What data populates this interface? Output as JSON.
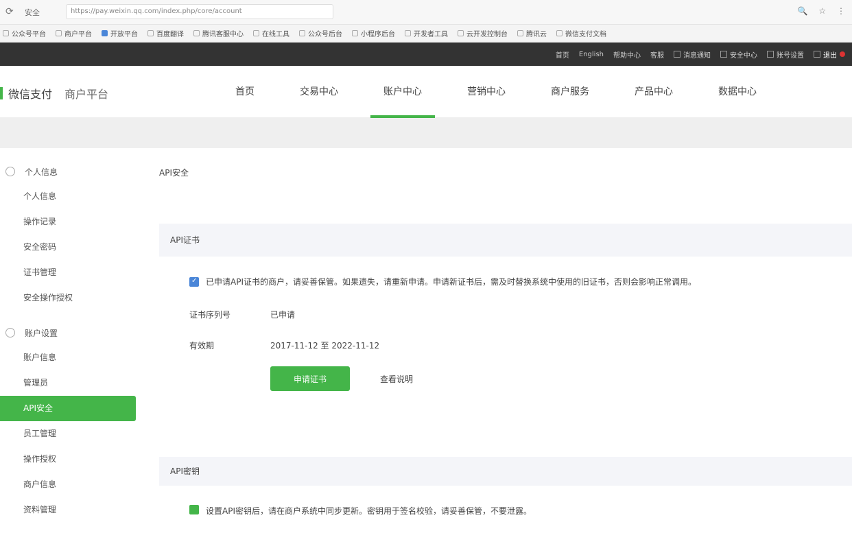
{
  "browser": {
    "secure_label": "安全",
    "url": "https://pay.weixin.qq.com/index.php/core/account",
    "bookmarks": [
      "公众号平台",
      "商户平台",
      "开放平台",
      "百度翻译",
      "腾讯客服中心",
      "在线工具",
      "公众号后台",
      "小程序后台",
      "开发者工具",
      "云开发控制台",
      "腾讯云",
      "微信支付文档"
    ]
  },
  "topbar": {
    "links": [
      "首页",
      "English",
      "帮助中心",
      "客服",
      "消息通知",
      "安全中心",
      "账号设置",
      "退出"
    ]
  },
  "header": {
    "brand_primary": "微信支付",
    "brand_secondary": "商户平台",
    "nav": [
      "首页",
      "交易中心",
      "账户中心",
      "营销中心",
      "商户服务",
      "产品中心",
      "数据中心"
    ],
    "active_nav_index": 2
  },
  "sidebar": {
    "group1_label": "个人信息",
    "group1_items": [
      "个人信息",
      "操作记录",
      "安全密码",
      "证书管理",
      "安全操作授权"
    ],
    "group2_label": "账户设置",
    "group2_items": [
      "账户信息",
      "管理员",
      "API安全",
      "员工管理",
      "操作授权",
      "商户信息",
      "资料管理"
    ],
    "active_item": "API安全"
  },
  "main": {
    "breadcrumb": "API安全",
    "section1_title": "API证书",
    "notice_text": "已申请API证书的商户，请妥善保管。如果遗失，请重新申请。申请新证书后，需及时替换系统中使用的旧证书，否则会影响正常调用。",
    "field1_label": "证书序列号",
    "field1_value": "已申请",
    "field2_label": "有效期",
    "field2_value": "2017-11-12 至 2022-11-12",
    "primary_button": "申请证书",
    "secondary_link": "查看说明",
    "section2_title": "API密钥",
    "notice2_text": "设置API密钥后，请在商户系统中同步更新。密钥用于签名校验，请妥善保管，不要泄露。"
  }
}
